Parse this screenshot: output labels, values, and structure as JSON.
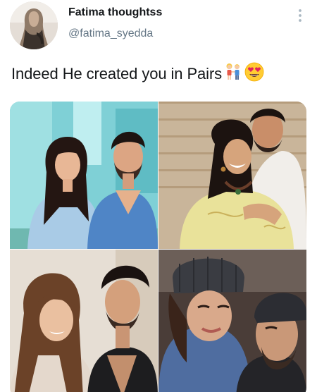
{
  "tweet": {
    "display_name": "Fatima thoughtss",
    "handle": "@fatima_syedda",
    "text": "Indeed He created you in Pairs",
    "emojis": [
      "couple-icon",
      "heart-eyes-emoji-icon"
    ]
  },
  "icons": {
    "more": "more-vertical-icon",
    "avatar": "avatar-hijab-figure-icon"
  },
  "media": {
    "count": 4,
    "photos": [
      {
        "name": "photo-couple-1"
      },
      {
        "name": "photo-couple-2"
      },
      {
        "name": "photo-couple-3"
      },
      {
        "name": "photo-couple-4"
      }
    ]
  },
  "colors": {
    "name": "#14171a",
    "handle": "#657786",
    "more_icon": "#aab8c2"
  }
}
